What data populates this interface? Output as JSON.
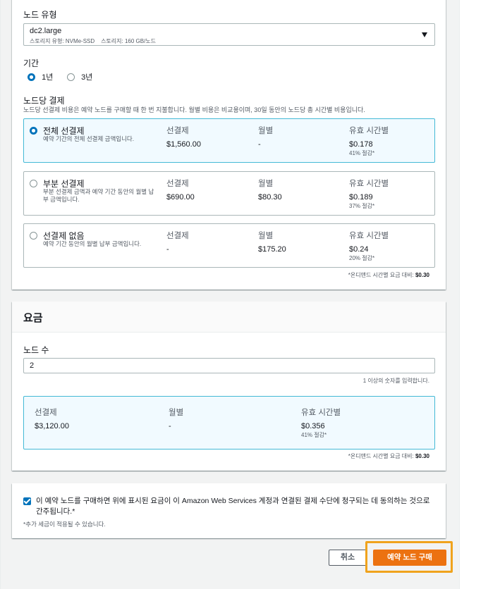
{
  "node_type": {
    "label": "노드 유형",
    "value": "dc2.large",
    "storage_type": "스토리지 유형: NVMe-SSD",
    "storage": "스토리지: 160 GB/노드"
  },
  "term": {
    "label": "기간",
    "options": [
      {
        "label": "1년",
        "selected": true
      },
      {
        "label": "3년",
        "selected": false
      }
    ]
  },
  "payment": {
    "label": "노드당 결제",
    "description": "노드당 선결제 비용은 예약 노드를 구매할 때 한 번 지불합니다. 월별 비용은 비교용이며, 30일 동안의 노드당 총 시간별 비용입니다.",
    "col_upfront": "선결제",
    "col_monthly": "월별",
    "col_hourly": "유효 시간별",
    "options": [
      {
        "title": "전체 선결제",
        "desc": "예약 기간의 전체 선결제 금액입니다.",
        "upfront": "$1,560.00",
        "monthly": "-",
        "hourly": "$0.178",
        "savings": "41% 절감*",
        "selected": true
      },
      {
        "title": "부분 선결제",
        "desc": "부분 선결제 금액과 예약 기간 동안의 월별 납부 금액입니다.",
        "upfront": "$690.00",
        "monthly": "$80.30",
        "hourly": "$0.189",
        "savings": "37% 절감*",
        "selected": false
      },
      {
        "title": "선결제 없음",
        "desc": "예약 기간 동안의 월별 납부 금액입니다.",
        "upfront": "-",
        "monthly": "$175.20",
        "hourly": "$0.24",
        "savings": "20% 절감*",
        "selected": false
      }
    ],
    "footnote_prefix": "*온디맨드 시간별 요금 대비: ",
    "footnote_value": "$0.30"
  },
  "pricing": {
    "heading": "요금",
    "nodes_label": "노드 수",
    "nodes_value": "2",
    "nodes_hint": "1 이상의 숫자를 입력합니다.",
    "upfront_label": "선결제",
    "upfront_value": "$3,120.00",
    "monthly_label": "월별",
    "monthly_value": "-",
    "hourly_label": "유효 시간별",
    "hourly_value": "$0.356",
    "savings": "41% 절감*",
    "footnote_prefix": "*온디맨드 시간별 요금 대비: ",
    "footnote_value": "$0.30"
  },
  "agreement": {
    "text": "이 예약 노드를 구매하면 위에 표시된 요금이 이 Amazon Web Services 계정과 연결된 결제 수단에 청구되는 데 동의하는 것으로 간주됩니다.*",
    "tax_note": "*추가 세금이 적용될 수 있습니다.",
    "checked": true
  },
  "actions": {
    "cancel": "취소",
    "purchase": "예약 노드 구매"
  },
  "colors": {
    "primary": "#ec7211",
    "selected_border": "#44b9d6",
    "selected_bg": "#f1faff",
    "radio": "#0073bb",
    "focus": "#f0a31d"
  }
}
